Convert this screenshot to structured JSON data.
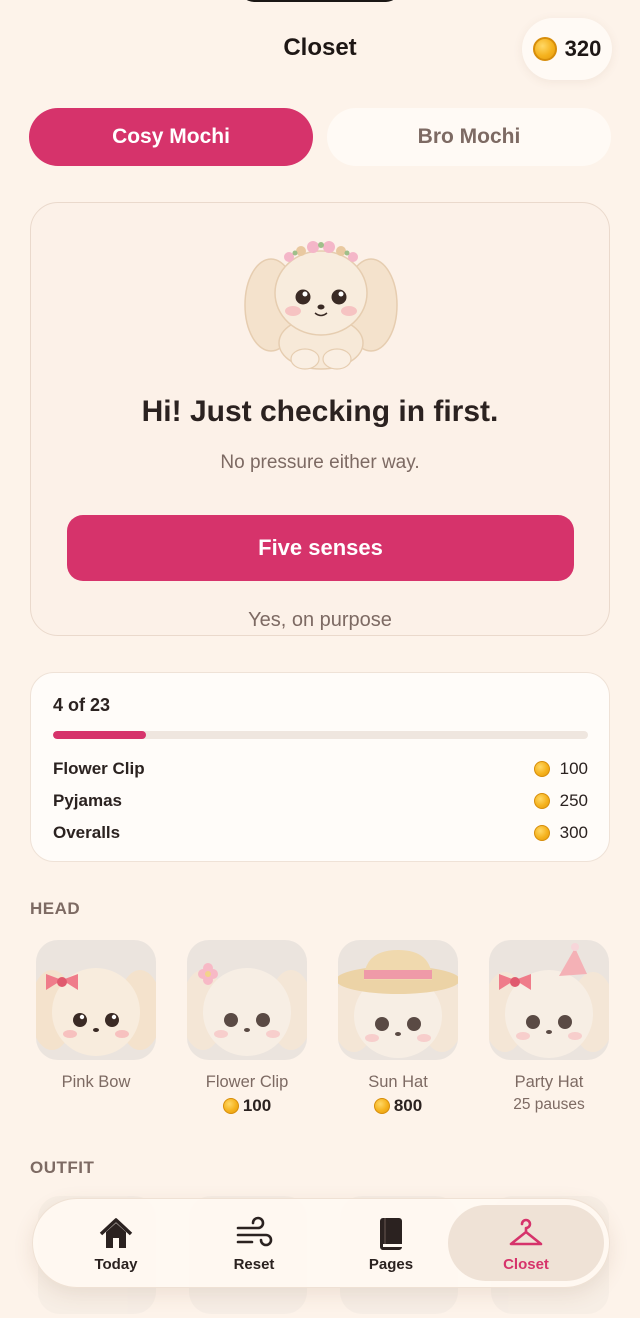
{
  "header": {
    "title": "Closet",
    "coins": "320"
  },
  "tabs": [
    {
      "label": "Cosy Mochi",
      "active": true
    },
    {
      "label": "Bro Mochi",
      "active": false
    }
  ],
  "checkin": {
    "title": "Hi! Just checking in first.",
    "subtitle": "No pressure either way.",
    "primary_label": "Five senses",
    "secondary_label": "Yes, on purpose"
  },
  "progress": {
    "count_label": "4 of 23",
    "fraction": 0.174,
    "goals": [
      {
        "name": "Flower Clip",
        "cost": "100"
      },
      {
        "name": "Pyjamas",
        "cost": "250"
      },
      {
        "name": "Overalls",
        "cost": "300"
      }
    ]
  },
  "sections": {
    "head": "HEAD",
    "outfit": "OUTFIT"
  },
  "head_items": [
    {
      "name": "Pink Bow",
      "price": "",
      "note": ""
    },
    {
      "name": "Flower Clip",
      "price": "100",
      "note": ""
    },
    {
      "name": "Sun Hat",
      "price": "800",
      "note": ""
    },
    {
      "name": "Party Hat",
      "price": "",
      "note": "25 pauses"
    }
  ],
  "nav": [
    {
      "label": "Today",
      "icon": "house-icon"
    },
    {
      "label": "Reset",
      "icon": "wind-icon"
    },
    {
      "label": "Pages",
      "icon": "book-icon"
    },
    {
      "label": "Closet",
      "icon": "hanger-icon",
      "active": true
    }
  ],
  "colors": {
    "accent": "#d6336b",
    "background": "#fdf3ea",
    "card": "#fcf1e8",
    "coin": "#f5b21e"
  }
}
